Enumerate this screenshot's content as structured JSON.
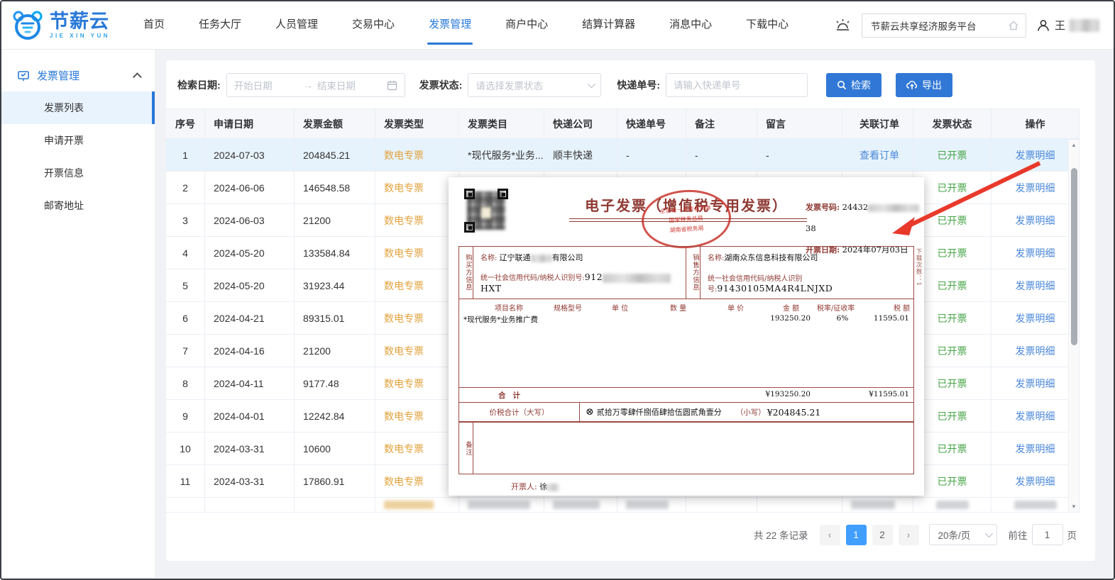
{
  "colors": {
    "accent": "#3178d6",
    "link": "#4a87d9",
    "tag_orange": "#e2a23c",
    "status_green": "#47a447",
    "invoice_red": "#8f3a33",
    "arrow_red": "#e8392b",
    "pager_active": "#409eff"
  },
  "header": {
    "logo_title": "节薪云",
    "logo_subtitle": "JIE XIN YUN",
    "nav": [
      "首页",
      "任务大厅",
      "人员管理",
      "交易中心",
      "发票管理",
      "商户中心",
      "结算计算器",
      "消息中心",
      "下载中心"
    ],
    "search_value": "节薪云共享经济服务平台",
    "user_name": "王"
  },
  "sidebar": {
    "group_label": "发票管理",
    "items": [
      "发票列表",
      "申请开票",
      "开票信息",
      "邮寄地址"
    ]
  },
  "filters": {
    "date_label": "检索日期:",
    "date_start_placeholder": "开始日期",
    "date_separator": "→",
    "date_end_placeholder": "结束日期",
    "status_label": "发票状态:",
    "status_placeholder": "请选择发票状态",
    "tracking_label": "快递单号:",
    "tracking_placeholder": "请输入快递单号",
    "search_button": "检索",
    "export_button": "导出"
  },
  "table": {
    "columns": [
      "序号",
      "申请日期",
      "发票金额",
      "发票类型",
      "发票类目",
      "快递公司",
      "快递单号",
      "备注",
      "留言",
      "关联订单",
      "发票状态",
      "操作"
    ],
    "rows": [
      {
        "no": "1",
        "date": "2024-07-03",
        "amount": "204845.21",
        "type": "数电专票",
        "category": "*现代服务*业务...",
        "courier": "顺丰快递",
        "tracking": "-",
        "remark": "-",
        "message": "-",
        "order": "查看订单",
        "status": "已开票",
        "action": "发票明细",
        "highlight": true
      },
      {
        "no": "2",
        "date": "2024-06-06",
        "amount": "146548.58",
        "type": "数电专票",
        "category": "",
        "courier": "",
        "tracking": "",
        "remark": "",
        "message": "",
        "order": "",
        "status": "已开票",
        "action": "发票明细"
      },
      {
        "no": "3",
        "date": "2024-06-03",
        "amount": "21200",
        "type": "数电专票",
        "category": "",
        "courier": "",
        "tracking": "",
        "remark": "",
        "message": "",
        "order": "",
        "status": "已开票",
        "action": "发票明细"
      },
      {
        "no": "4",
        "date": "2024-05-20",
        "amount": "133584.84",
        "type": "数电专票",
        "category": "",
        "courier": "",
        "tracking": "",
        "remark": "",
        "message": "",
        "order": "",
        "status": "已开票",
        "action": "发票明细"
      },
      {
        "no": "5",
        "date": "2024-05-20",
        "amount": "31923.44",
        "type": "数电专票",
        "category": "",
        "courier": "",
        "tracking": "",
        "remark": "",
        "message": "",
        "order": "",
        "status": "已开票",
        "action": "发票明细"
      },
      {
        "no": "6",
        "date": "2024-04-21",
        "amount": "89315.01",
        "type": "数电专票",
        "category": "",
        "courier": "",
        "tracking": "",
        "remark": "",
        "message": "",
        "order": "",
        "status": "已开票",
        "action": "发票明细"
      },
      {
        "no": "7",
        "date": "2024-04-16",
        "amount": "21200",
        "type": "数电专票",
        "category": "",
        "courier": "",
        "tracking": "",
        "remark": "",
        "message": "",
        "order": "",
        "status": "已开票",
        "action": "发票明细"
      },
      {
        "no": "8",
        "date": "2024-04-11",
        "amount": "9177.48",
        "type": "数电专票",
        "category": "",
        "courier": "",
        "tracking": "",
        "remark": "",
        "message": "",
        "order": "",
        "status": "已开票",
        "action": "发票明细"
      },
      {
        "no": "9",
        "date": "2024-04-01",
        "amount": "12242.84",
        "type": "数电专票",
        "category": "",
        "courier": "",
        "tracking": "",
        "remark": "",
        "message": "",
        "order": "",
        "status": "已开票",
        "action": "发票明细"
      },
      {
        "no": "10",
        "date": "2024-03-31",
        "amount": "10600",
        "type": "数电专票",
        "category": "",
        "courier": "",
        "tracking": "",
        "remark": "",
        "message": "",
        "order": "",
        "status": "已开票",
        "action": "发票明细"
      },
      {
        "no": "11",
        "date": "2024-03-31",
        "amount": "17860.91",
        "type": "数电专票",
        "category": "",
        "courier": "",
        "tracking": "",
        "remark": "",
        "message": "",
        "order": "",
        "status": "已开票",
        "action": "发票明细"
      }
    ]
  },
  "pagination": {
    "total_text": "共 22 条记录",
    "prev": "‹",
    "pages": [
      "1",
      "2"
    ],
    "next": "›",
    "page_size": "20条/页",
    "goto_label": "前往",
    "goto_value": "1",
    "goto_suffix": "页"
  },
  "invoice": {
    "title": "电子发票（增值税专用发票）",
    "stamp_arc": "全国统一发票监制章",
    "stamp_line1": "国家税务总局",
    "stamp_line2": "湖南省税务局",
    "number_label": "发票号码:",
    "number_prefix": "24432",
    "number_suffix": "38",
    "date_label": "开票日期:",
    "date_value": "2024年07月03日",
    "buyer_side_label": "购买方信息",
    "seller_side_label": "销售方信息",
    "name_label": "名称:",
    "tax_id_label": "统一社会信用代码/纳税人识别号:",
    "buyer_name_prefix": "辽宁联通",
    "buyer_name_suffix": "有限公司",
    "buyer_tax_prefix": "912",
    "buyer_tax_suffix": "HXT",
    "seller_name": "湖南众东信息科技有限公司",
    "seller_tax_id": "91430105MA4R4LNJXD",
    "download_count": "下载次数：1",
    "items_header": [
      "项目名称",
      "规格型号",
      "单 位",
      "数 量",
      "单 价",
      "金 额",
      "税率/征收率",
      "税 额"
    ],
    "item_name": "*现代服务*业务推广费",
    "item_amount": "193250.20",
    "item_tax_rate": "6%",
    "item_tax": "11595.01",
    "total_label": "合计",
    "total_amount": "¥193250.20",
    "total_tax": "¥11595.01",
    "grand_label": "价税合计（大写）",
    "grand_symbol": "⊗",
    "grand_words": "贰拾万零肆仟捌佰肆拾伍圆贰角壹分",
    "grand_small_label": "（小写）",
    "grand_value": "¥204845.21",
    "remark_label": "备注",
    "issuer_label": "开票人:",
    "issuer_name": "徐"
  }
}
